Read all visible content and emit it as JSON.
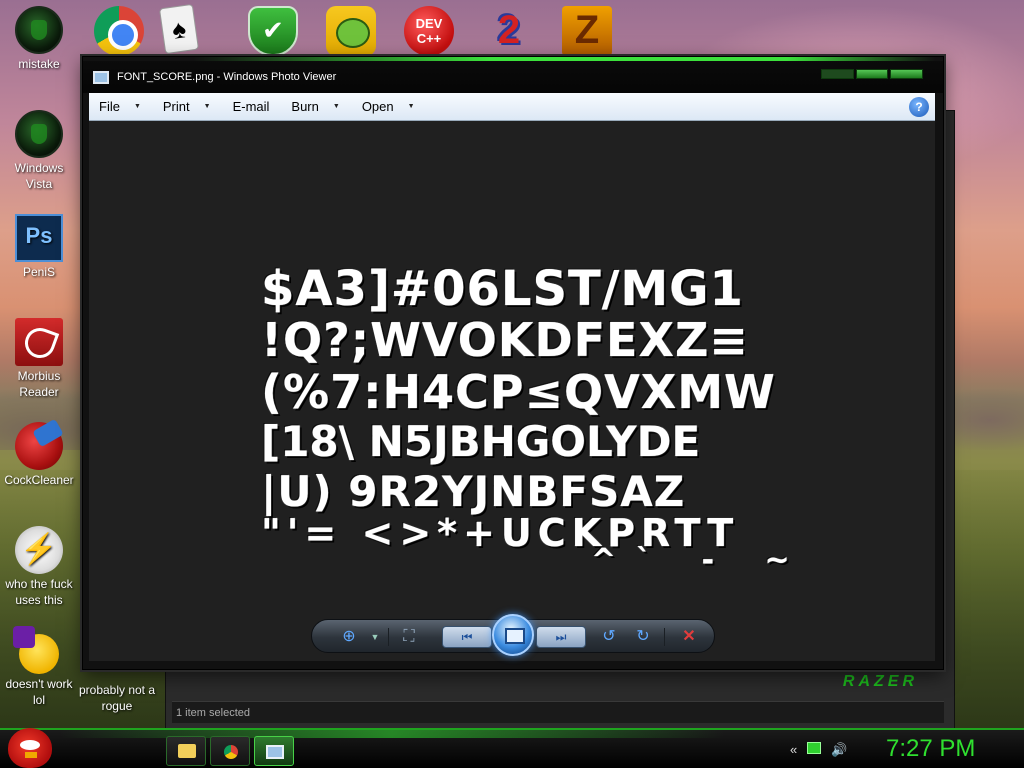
{
  "desktop": {
    "left_icons": [
      {
        "label": "mistake"
      },
      {
        "label": "Windows Vista"
      },
      {
        "label": "PeniS"
      },
      {
        "label": "Morbius Reader"
      },
      {
        "label": "CockCleaner"
      },
      {
        "label": "who the fuck uses this"
      },
      {
        "label": "doesn't work lol"
      },
      {
        "label": "probably not a rogue"
      }
    ],
    "top_icons": [
      {
        "name": "chrome-icon"
      },
      {
        "name": "solitaire-icon"
      },
      {
        "name": "security-shield-icon"
      },
      {
        "name": "bad-piggies-icon"
      },
      {
        "name": "devcpp-icon",
        "text": "DEV C++"
      },
      {
        "name": "two-icon",
        "text": "2"
      },
      {
        "name": "z-icon",
        "text": "Z"
      }
    ]
  },
  "viewer": {
    "title": "FONT_SCORE.png - Windows Photo Viewer",
    "menu": [
      {
        "label": "File",
        "has_arrow": true
      },
      {
        "label": "Print",
        "has_arrow": true
      },
      {
        "label": "E-mail",
        "has_arrow": false
      },
      {
        "label": "Burn",
        "has_arrow": true
      },
      {
        "label": "Open",
        "has_arrow": true
      }
    ],
    "help_icon": "?",
    "image_rows": [
      "$A3]#06LST/MG1",
      "!Q?;WVOKDFEXZ≡",
      "(%7:H4CP≤QVXMW",
      "[18\\ N5JBHGOLYDE",
      "|U) 9R2YJNBFSAZ",
      "\"'= <>*+UCKPRTT",
      "^` - ~"
    ],
    "toolbar": {
      "zoom": "zoom-icon",
      "fit": "actual-size-icon",
      "prev": "previous-icon",
      "slideshow": "slideshow-icon",
      "next": "next-icon",
      "rotate_ccw": "rotate-counterclockwise-icon",
      "rotate_cw": "rotate-clockwise-icon",
      "delete": "delete-icon"
    }
  },
  "background_window": {
    "status": "1 item selected",
    "brand": "RAZER"
  },
  "taskbar": {
    "clock": "7:27 PM",
    "colors": {
      "accent": "#2fe02f"
    }
  }
}
